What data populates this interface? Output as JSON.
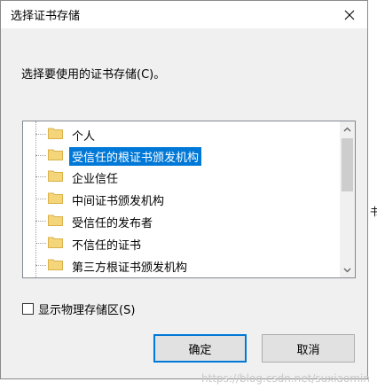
{
  "window": {
    "title": "选择证书存储"
  },
  "prompt": "选择要使用的证书存储(C)。",
  "tree": {
    "items": [
      {
        "label": "个人",
        "selected": false
      },
      {
        "label": "受信任的根证书颁发机构",
        "selected": true
      },
      {
        "label": "企业信任",
        "selected": false
      },
      {
        "label": "中间证书颁发机构",
        "selected": false
      },
      {
        "label": "受信任的发布者",
        "selected": false
      },
      {
        "label": "不信任的证书",
        "selected": false
      },
      {
        "label": "第三方根证书颁发机构",
        "selected": false
      }
    ]
  },
  "checkbox": {
    "label": "显示物理存储区(S)",
    "checked": false
  },
  "buttons": {
    "ok": "确定",
    "cancel": "取消"
  },
  "side_text": "书",
  "watermark": "https://blog.csdn.net/suxiaomin",
  "colors": {
    "selection": "#0078d7",
    "folder": "#f5d57a"
  }
}
